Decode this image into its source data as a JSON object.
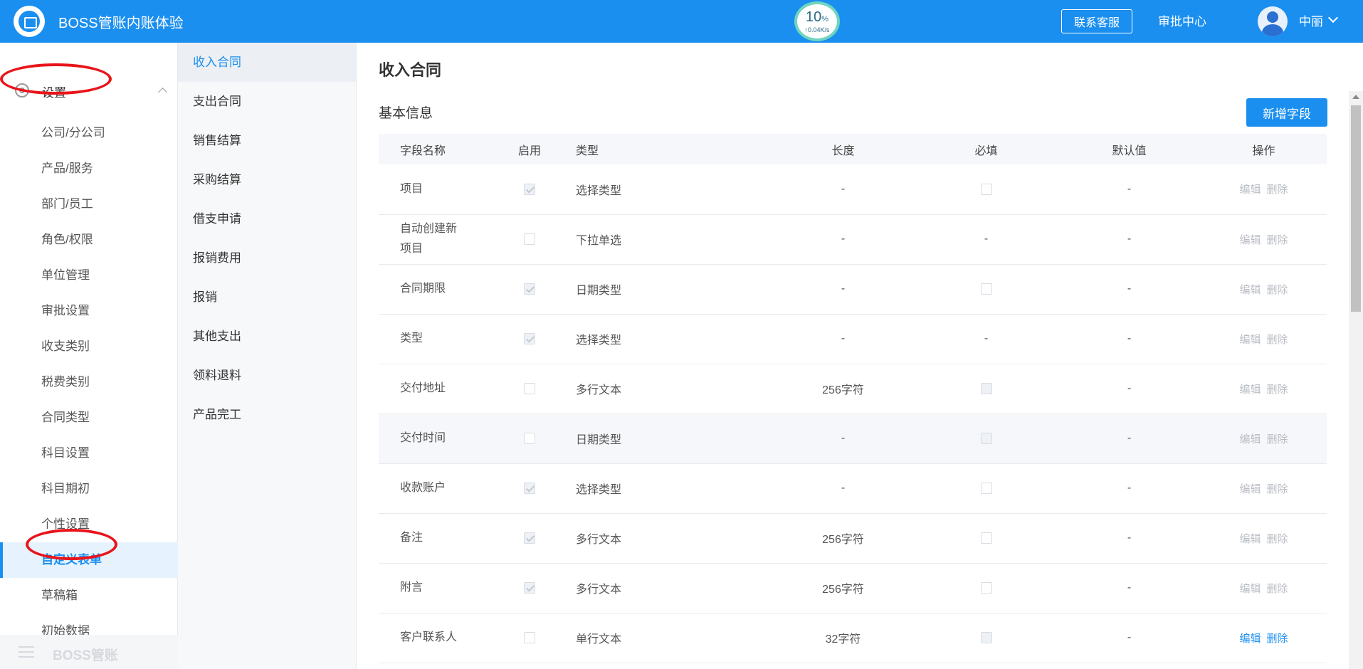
{
  "header": {
    "app_title": "BOSS管账内账体验",
    "net_percent": "10",
    "net_percent_unit": "%",
    "net_speed": "↑0.04K/s",
    "contact_label": "联系客服",
    "approval_label": "审批中心",
    "user_name": "中丽"
  },
  "sidebar": {
    "section_label": "设置",
    "items": [
      "公司/分公司",
      "产品/服务",
      "部门/员工",
      "角色/权限",
      "单位管理",
      "审批设置",
      "收支类别",
      "税费类别",
      "合同类型",
      "科目设置",
      "科目期初",
      "个性设置",
      "自定义表单",
      "草稿箱",
      "初始数据"
    ],
    "active_index": 12,
    "footer_label": "BOSS管账"
  },
  "submenu": {
    "items": [
      "收入合同",
      "支出合同",
      "销售结算",
      "采购结算",
      "借支申请",
      "报销费用",
      "报销",
      "其他支出",
      "领料退料",
      "产品完工"
    ],
    "active_index": 0
  },
  "main": {
    "page_title": "收入合同",
    "section_title": "基本信息",
    "add_button": "新增字段",
    "columns": [
      "字段名称",
      "启用",
      "类型",
      "长度",
      "必填",
      "默认值",
      "操作"
    ],
    "edit_label": "编辑",
    "delete_label": "删除",
    "rows": [
      {
        "name": "项目",
        "enabled": "checked-disabled",
        "type": "选择类型",
        "length": "-",
        "required": "empty",
        "default": "-",
        "ops_active": false
      },
      {
        "name": "自动创建新项目",
        "enabled": "empty",
        "type": "下拉单选",
        "length": "-",
        "required": "-",
        "default": "-",
        "ops_active": false
      },
      {
        "name": "合同期限",
        "enabled": "checked-disabled",
        "type": "日期类型",
        "length": "-",
        "required": "empty",
        "default": "-",
        "ops_active": false
      },
      {
        "name": "类型",
        "enabled": "checked-disabled",
        "type": "选择类型",
        "length": "-",
        "required": "-",
        "default": "-",
        "ops_active": false
      },
      {
        "name": "交付地址",
        "enabled": "empty",
        "type": "多行文本",
        "length": "256字符",
        "required": "disabled",
        "default": "-",
        "ops_active": false
      },
      {
        "name": "交付时间",
        "enabled": "empty",
        "type": "日期类型",
        "length": "-",
        "required": "disabled",
        "default": "-",
        "ops_active": false
      },
      {
        "name": "收款账户",
        "enabled": "checked-disabled",
        "type": "选择类型",
        "length": "-",
        "required": "empty",
        "default": "-",
        "ops_active": false
      },
      {
        "name": "备注",
        "enabled": "checked-disabled",
        "type": "多行文本",
        "length": "256字符",
        "required": "empty",
        "default": "-",
        "ops_active": false
      },
      {
        "name": "附言",
        "enabled": "checked-disabled",
        "type": "多行文本",
        "length": "256字符",
        "required": "empty",
        "default": "-",
        "ops_active": false
      },
      {
        "name": "客户联系人",
        "enabled": "empty",
        "type": "单行文本",
        "length": "32字符",
        "required": "disabled",
        "default": "-",
        "ops_active": true
      }
    ]
  },
  "colors": {
    "primary": "#1b8ff0",
    "annotation_ring": "#e8141a",
    "muted_op": "#b8bcc4"
  }
}
